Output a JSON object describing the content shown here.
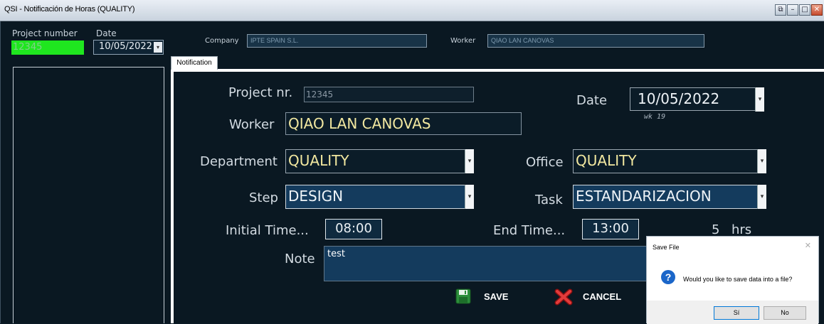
{
  "window": {
    "title": "QSI - Notificación de Horas (QUALITY)"
  },
  "top": {
    "project_number_label": "Project number",
    "project_number_value": "12345",
    "date_label": "Date",
    "date_value": "10/05/2022",
    "company_label": "Company",
    "company_value": "IPTE SPAIN S.L.",
    "worker_label": "Worker",
    "worker_value": "QIAO LAN CANOVAS"
  },
  "tab": {
    "label": "Notification"
  },
  "form": {
    "project_nr_label": "Project nr.",
    "project_nr_value": "12345",
    "date_label": "Date",
    "date_value": "10/05/2022",
    "week_label": "wk  19",
    "worker_label": "Worker",
    "worker_value": "QIAO LAN CANOVAS",
    "department_label": "Department",
    "department_value": "QUALITY",
    "office_label": "Office",
    "office_value": "QUALITY",
    "step_label": "Step",
    "step_value": "DESIGN",
    "task_label": "Task",
    "task_value": "ESTANDARIZACION",
    "initial_time_label": "Initial Time...",
    "initial_time_value": "08:00",
    "end_time_label": "End Time...",
    "end_time_value": "13:00",
    "hours_value": "5",
    "hours_unit": "hrs",
    "note_label": "Note",
    "note_value": "test",
    "save_label": "SAVE",
    "cancel_label": "CANCEL"
  },
  "dialog": {
    "title": "Save File",
    "message": "Would you like to save data into a file?",
    "yes_label": "Sí",
    "no_label": "No"
  },
  "colors": {
    "background": "#0a1822",
    "project_number_bg": "#1fe61f",
    "combo_bg": "#143b5d",
    "value_text": "#f2e8a0",
    "dialog_icon": "#1b66c9"
  }
}
